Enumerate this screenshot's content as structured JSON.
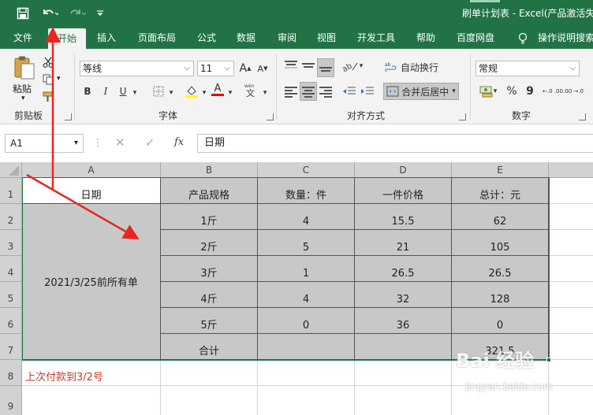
{
  "window": {
    "title": "刷单计划表 - Excel(产品激活失"
  },
  "tabs": [
    "文件",
    "开始",
    "插入",
    "页面布局",
    "公式",
    "数据",
    "审阅",
    "视图",
    "开发工具",
    "帮助",
    "百度网盘",
    "操作说明搜索"
  ],
  "active_tab": "开始",
  "ribbon": {
    "clipboard": {
      "paste_label": "粘贴",
      "group_label": "剪贴板"
    },
    "font": {
      "font_name": "等线",
      "font_size": "11",
      "bold": "B",
      "italic": "I",
      "underline": "U",
      "font_color_glyph": "A",
      "grow_glyph": "A",
      "shrink_glyph": "A",
      "group_label": "字体"
    },
    "alignment": {
      "wrap_text": "自动换行",
      "merge_center": "合并后居中",
      "group_label": "对齐方式"
    },
    "number": {
      "format": "常规",
      "percent": "%",
      "comma": "9",
      "inc_decimal": "←.0 .00",
      "dec_decimal": ".00 →.0",
      "group_label": "数字"
    }
  },
  "formula_bar": {
    "name_box": "A1",
    "fx": "fx",
    "content": "日期"
  },
  "sheet": {
    "columns": [
      "A",
      "B",
      "C",
      "D",
      "E"
    ],
    "rows": [
      "1",
      "2",
      "3",
      "4",
      "5",
      "6",
      "7",
      "8",
      "9"
    ],
    "header": [
      "日期",
      "产品规格",
      "数量：件",
      "一件价格",
      "总计：元"
    ],
    "merged_a": "2021/3/25前所有单",
    "data": [
      [
        "1斤",
        "4",
        "15.5",
        "62"
      ],
      [
        "2斤",
        "5",
        "21",
        "105"
      ],
      [
        "3斤",
        "1",
        "26.5",
        "26.5"
      ],
      [
        "4斤",
        "4",
        "32",
        "128"
      ],
      [
        "5斤",
        "0",
        "36",
        "0"
      ]
    ],
    "total_label": "合计",
    "total_value": "321.5",
    "note": "上次付款到3/2号"
  },
  "colors": {
    "excel_green": "#217346",
    "note_red": "#c0392b",
    "arrow_red": "#e8261f",
    "selection_gray": "#c8c8c8"
  },
  "watermark": {
    "brand": "Bai 经验",
    "url": "jingyan.baidu.com"
  }
}
